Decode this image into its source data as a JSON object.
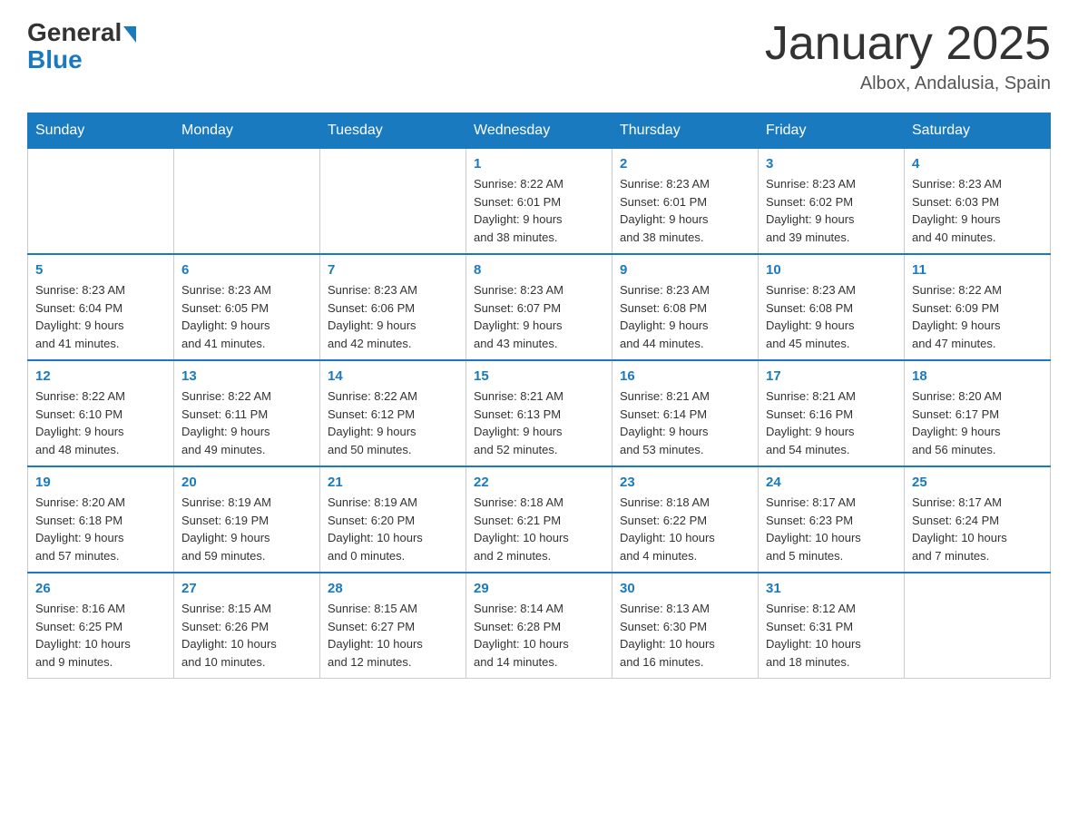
{
  "header": {
    "logo_text_general": "General",
    "logo_text_blue": "Blue",
    "month_title": "January 2025",
    "location": "Albox, Andalusia, Spain"
  },
  "days_of_week": [
    "Sunday",
    "Monday",
    "Tuesday",
    "Wednesday",
    "Thursday",
    "Friday",
    "Saturday"
  ],
  "weeks": [
    {
      "cells": [
        {
          "day": "",
          "info": ""
        },
        {
          "day": "",
          "info": ""
        },
        {
          "day": "",
          "info": ""
        },
        {
          "day": "1",
          "info": "Sunrise: 8:22 AM\nSunset: 6:01 PM\nDaylight: 9 hours\nand 38 minutes."
        },
        {
          "day": "2",
          "info": "Sunrise: 8:23 AM\nSunset: 6:01 PM\nDaylight: 9 hours\nand 38 minutes."
        },
        {
          "day": "3",
          "info": "Sunrise: 8:23 AM\nSunset: 6:02 PM\nDaylight: 9 hours\nand 39 minutes."
        },
        {
          "day": "4",
          "info": "Sunrise: 8:23 AM\nSunset: 6:03 PM\nDaylight: 9 hours\nand 40 minutes."
        }
      ]
    },
    {
      "cells": [
        {
          "day": "5",
          "info": "Sunrise: 8:23 AM\nSunset: 6:04 PM\nDaylight: 9 hours\nand 41 minutes."
        },
        {
          "day": "6",
          "info": "Sunrise: 8:23 AM\nSunset: 6:05 PM\nDaylight: 9 hours\nand 41 minutes."
        },
        {
          "day": "7",
          "info": "Sunrise: 8:23 AM\nSunset: 6:06 PM\nDaylight: 9 hours\nand 42 minutes."
        },
        {
          "day": "8",
          "info": "Sunrise: 8:23 AM\nSunset: 6:07 PM\nDaylight: 9 hours\nand 43 minutes."
        },
        {
          "day": "9",
          "info": "Sunrise: 8:23 AM\nSunset: 6:08 PM\nDaylight: 9 hours\nand 44 minutes."
        },
        {
          "day": "10",
          "info": "Sunrise: 8:23 AM\nSunset: 6:08 PM\nDaylight: 9 hours\nand 45 minutes."
        },
        {
          "day": "11",
          "info": "Sunrise: 8:22 AM\nSunset: 6:09 PM\nDaylight: 9 hours\nand 47 minutes."
        }
      ]
    },
    {
      "cells": [
        {
          "day": "12",
          "info": "Sunrise: 8:22 AM\nSunset: 6:10 PM\nDaylight: 9 hours\nand 48 minutes."
        },
        {
          "day": "13",
          "info": "Sunrise: 8:22 AM\nSunset: 6:11 PM\nDaylight: 9 hours\nand 49 minutes."
        },
        {
          "day": "14",
          "info": "Sunrise: 8:22 AM\nSunset: 6:12 PM\nDaylight: 9 hours\nand 50 minutes."
        },
        {
          "day": "15",
          "info": "Sunrise: 8:21 AM\nSunset: 6:13 PM\nDaylight: 9 hours\nand 52 minutes."
        },
        {
          "day": "16",
          "info": "Sunrise: 8:21 AM\nSunset: 6:14 PM\nDaylight: 9 hours\nand 53 minutes."
        },
        {
          "day": "17",
          "info": "Sunrise: 8:21 AM\nSunset: 6:16 PM\nDaylight: 9 hours\nand 54 minutes."
        },
        {
          "day": "18",
          "info": "Sunrise: 8:20 AM\nSunset: 6:17 PM\nDaylight: 9 hours\nand 56 minutes."
        }
      ]
    },
    {
      "cells": [
        {
          "day": "19",
          "info": "Sunrise: 8:20 AM\nSunset: 6:18 PM\nDaylight: 9 hours\nand 57 minutes."
        },
        {
          "day": "20",
          "info": "Sunrise: 8:19 AM\nSunset: 6:19 PM\nDaylight: 9 hours\nand 59 minutes."
        },
        {
          "day": "21",
          "info": "Sunrise: 8:19 AM\nSunset: 6:20 PM\nDaylight: 10 hours\nand 0 minutes."
        },
        {
          "day": "22",
          "info": "Sunrise: 8:18 AM\nSunset: 6:21 PM\nDaylight: 10 hours\nand 2 minutes."
        },
        {
          "day": "23",
          "info": "Sunrise: 8:18 AM\nSunset: 6:22 PM\nDaylight: 10 hours\nand 4 minutes."
        },
        {
          "day": "24",
          "info": "Sunrise: 8:17 AM\nSunset: 6:23 PM\nDaylight: 10 hours\nand 5 minutes."
        },
        {
          "day": "25",
          "info": "Sunrise: 8:17 AM\nSunset: 6:24 PM\nDaylight: 10 hours\nand 7 minutes."
        }
      ]
    },
    {
      "cells": [
        {
          "day": "26",
          "info": "Sunrise: 8:16 AM\nSunset: 6:25 PM\nDaylight: 10 hours\nand 9 minutes."
        },
        {
          "day": "27",
          "info": "Sunrise: 8:15 AM\nSunset: 6:26 PM\nDaylight: 10 hours\nand 10 minutes."
        },
        {
          "day": "28",
          "info": "Sunrise: 8:15 AM\nSunset: 6:27 PM\nDaylight: 10 hours\nand 12 minutes."
        },
        {
          "day": "29",
          "info": "Sunrise: 8:14 AM\nSunset: 6:28 PM\nDaylight: 10 hours\nand 14 minutes."
        },
        {
          "day": "30",
          "info": "Sunrise: 8:13 AM\nSunset: 6:30 PM\nDaylight: 10 hours\nand 16 minutes."
        },
        {
          "day": "31",
          "info": "Sunrise: 8:12 AM\nSunset: 6:31 PM\nDaylight: 10 hours\nand 18 minutes."
        },
        {
          "day": "",
          "info": ""
        }
      ]
    }
  ]
}
